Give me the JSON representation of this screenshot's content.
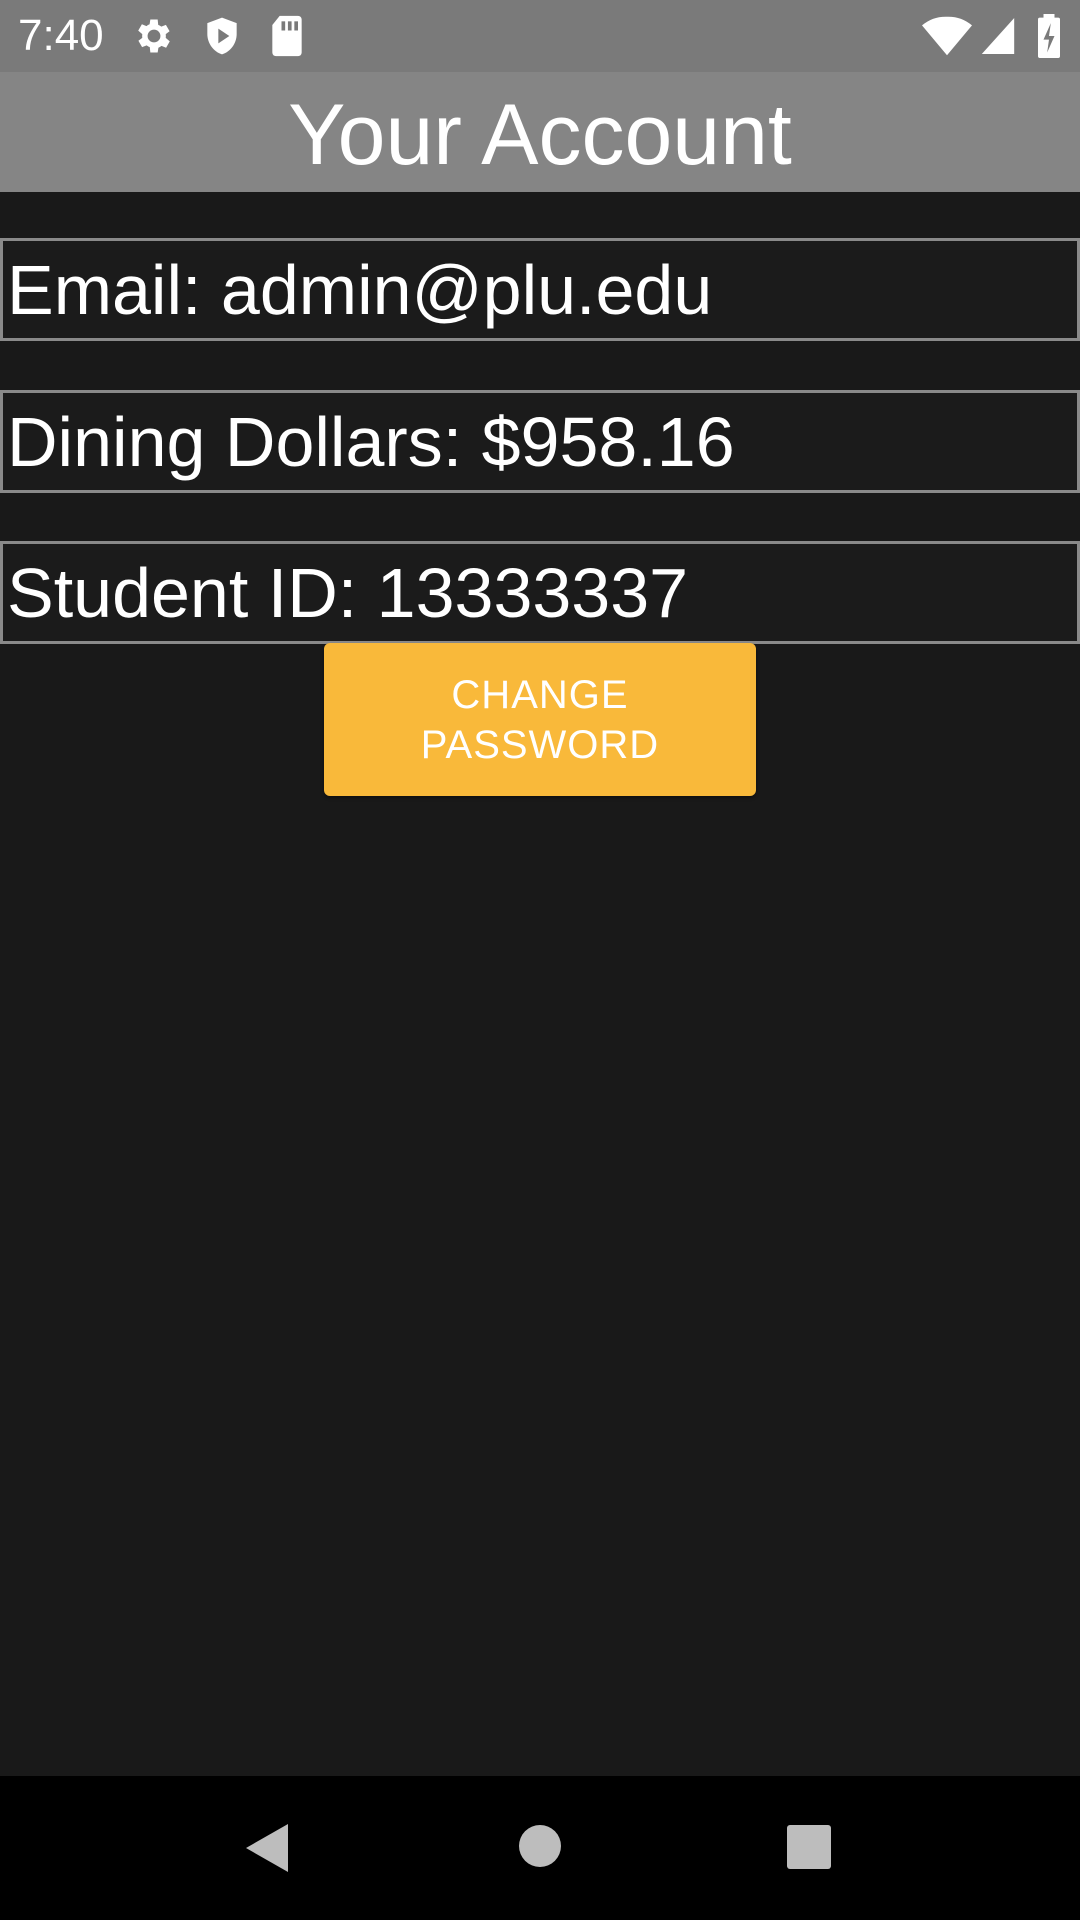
{
  "status_bar": {
    "time": "7:40",
    "icons": [
      "gear-icon",
      "shield-play-icon",
      "sd-card-icon",
      "wifi-icon",
      "signal-icon",
      "battery-charging-icon"
    ]
  },
  "header": {
    "title": "Your Account"
  },
  "account": {
    "email_line": "Email: admin@plu.edu",
    "dining_line": "Dining Dollars: $958.16",
    "student_id_line": "Student ID: 13333337"
  },
  "actions": {
    "change_password_label": "CHANGE PASSWORD"
  },
  "nav": {
    "icons": [
      "back-icon",
      "home-icon",
      "recents-icon"
    ]
  },
  "colors": {
    "background": "#191919",
    "status_bar": "#7a7a7a",
    "app_bar": "#858585",
    "accent": "#f9b93a",
    "box_border": "#8a8a8a"
  }
}
